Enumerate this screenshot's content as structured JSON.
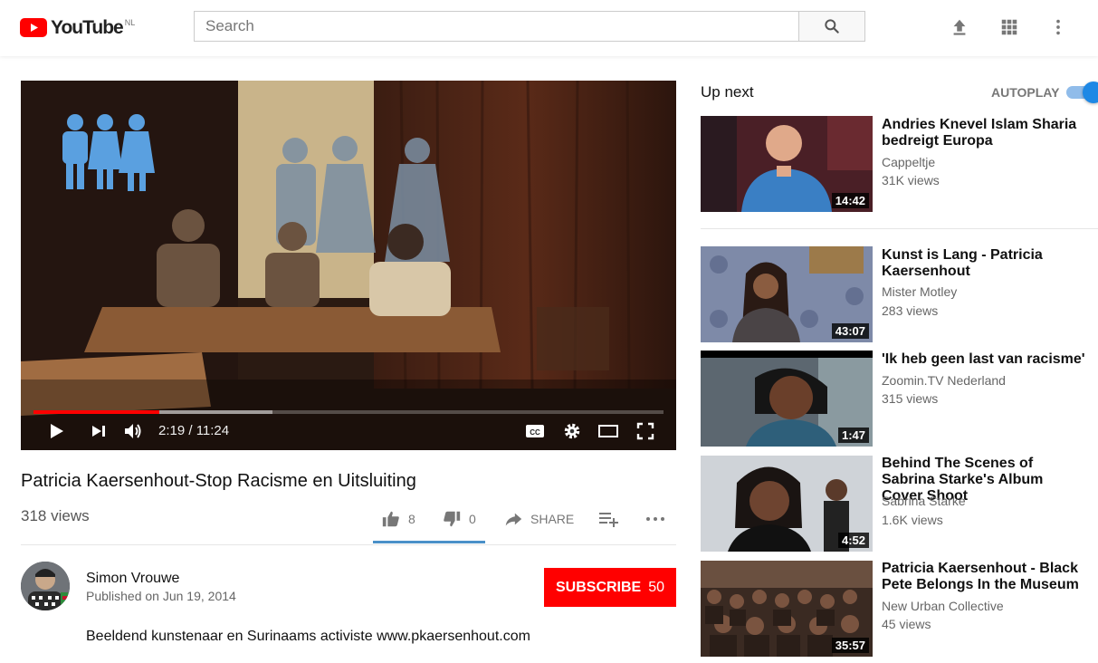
{
  "header": {
    "logo_text": "YouTube",
    "region": "NL",
    "search_placeholder": "Search"
  },
  "player": {
    "current_time": "2:19",
    "duration": "11:24",
    "time_display": "2:19 / 11:24",
    "progress_fraction": 0.2,
    "buffered_fraction": 0.38
  },
  "video": {
    "title": "Patricia Kaersenhout-Stop Racisme en Uitsluiting",
    "views": "318 views",
    "likes": "8",
    "dislikes": "0",
    "share_label": "SHARE",
    "like_ratio": 1.0
  },
  "owner": {
    "channel_name": "Simon Vrouwe",
    "published": "Published on Jun 19, 2014",
    "subscribe_label": "SUBSCRIBE",
    "subscriber_count": "50",
    "description": "Beeldend kunstenaar en Surinaams activiste www.pkaersenhout.com"
  },
  "sidebar": {
    "up_next_label": "Up next",
    "autoplay_label": "AUTOPLAY",
    "autoplay_on": true,
    "items": [
      {
        "title": "Andries Knevel Islam Sharia bedreigt Europa",
        "channel": "Cappeltje",
        "views": "31K views",
        "duration": "14:42"
      },
      {
        "title": "Kunst is Lang - Patricia Kaersenhout",
        "channel": "Mister Motley",
        "views": "283 views",
        "duration": "43:07"
      },
      {
        "title": "'Ik heb geen last van racisme'",
        "channel": "Zoomin.TV Nederland",
        "views": "315 views",
        "duration": "1:47"
      },
      {
        "title": "Behind The Scenes of Sabrina Starke's Album Cover Shoot",
        "channel": "Sabrina Starke",
        "views": "1.6K views",
        "duration": "4:52"
      },
      {
        "title": "Patricia Kaersenhout - Black Pete Belongs In the Museum",
        "channel": "New Urban Collective",
        "views": "45 views",
        "duration": "35:57"
      }
    ]
  },
  "colors": {
    "brand_red": "#ff0000",
    "accent_blue": "#1e88e5",
    "progress_red": "#ff0000"
  }
}
